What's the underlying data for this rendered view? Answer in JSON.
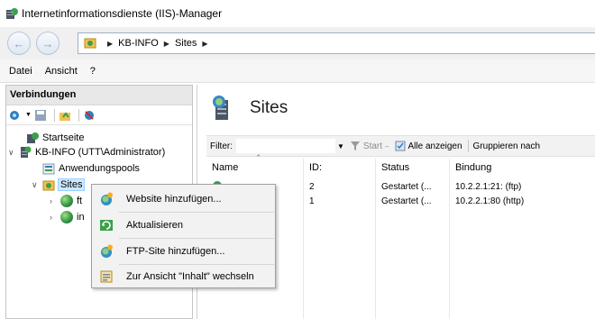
{
  "window": {
    "title": "Internetinformationsdienste (IIS)-Manager"
  },
  "address": {
    "crumbs": [
      "KB-INFO",
      "Sites"
    ]
  },
  "menubar": {
    "items": [
      "Datei",
      "Ansicht",
      "?"
    ]
  },
  "connections": {
    "header": "Verbindungen",
    "tree": {
      "startpage": "Startseite",
      "server": "KB-INFO (UTT\\Administrator)",
      "apppools": "Anwendungspools",
      "sites": "Sites",
      "child1": "ft",
      "child2": "in"
    }
  },
  "main": {
    "heading": "Sites",
    "filterbar": {
      "label": "Filter:",
      "start": "Start",
      "show_all": "Alle anzeigen",
      "group_by": "Gruppieren nach"
    },
    "columns": [
      "Name",
      "ID:",
      "Status",
      "Bindung"
    ],
    "rows": [
      {
        "id": "2",
        "status": "Gestartet (...",
        "binding": "10.2.2.1:21: (ftp)"
      },
      {
        "id": "1",
        "status": "Gestartet (...",
        "binding": "10.2.2.1:80 (http)"
      }
    ]
  },
  "context_menu": {
    "items": [
      {
        "label": "Website hinzufügen...",
        "icon": "add-website-icon"
      },
      {
        "label": "Aktualisieren",
        "icon": "refresh-icon"
      },
      {
        "label": "FTP-Site hinzufügen...",
        "icon": "add-ftp-site-icon"
      },
      {
        "label": "Zur Ansicht \"Inhalt\" wechseln",
        "icon": "content-view-icon"
      }
    ]
  },
  "colors": {
    "selection": "#cde8ff",
    "menu_bg": "#f2f2f2",
    "accent": "#2f8f3a"
  }
}
